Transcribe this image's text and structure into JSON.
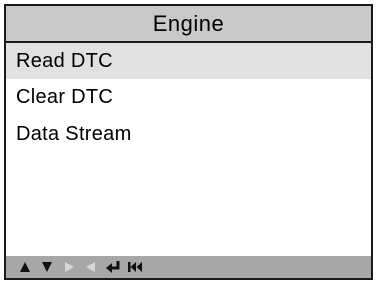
{
  "header": {
    "title": "Engine"
  },
  "menu": {
    "items": [
      {
        "label": "Read DTC",
        "selected": true
      },
      {
        "label": "Clear DTC",
        "selected": false
      },
      {
        "label": "Data Stream",
        "selected": false
      }
    ]
  },
  "footer": {
    "buttons": [
      {
        "icon": "up-arrow-icon",
        "enabled": true
      },
      {
        "icon": "down-arrow-icon",
        "enabled": true
      },
      {
        "icon": "right-arrow-icon",
        "enabled": false
      },
      {
        "icon": "left-arrow-icon",
        "enabled": false
      },
      {
        "icon": "enter-icon",
        "enabled": true
      },
      {
        "icon": "back-icon",
        "enabled": true
      }
    ]
  },
  "colors": {
    "title_bg": "#c9c9c9",
    "selected_bg": "#e1e1e1",
    "footer_bg": "#a7a7a7",
    "icon_enabled": "#111111",
    "icon_disabled": "#d8d8d8"
  }
}
